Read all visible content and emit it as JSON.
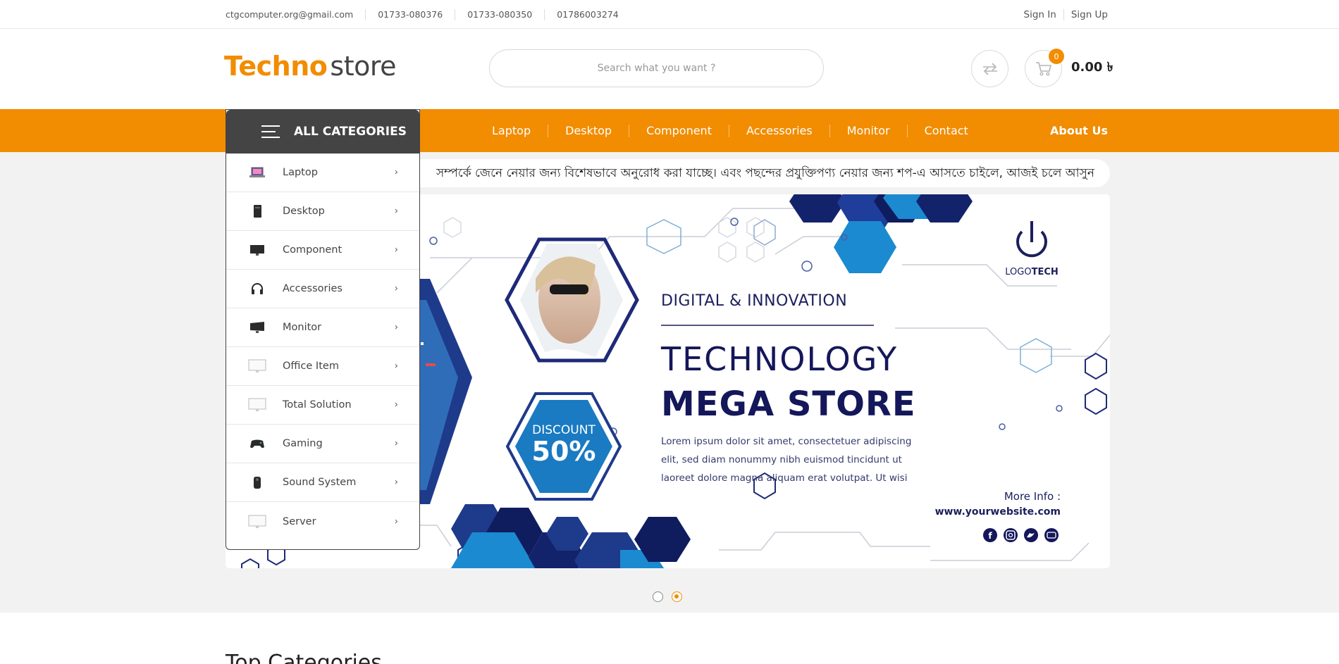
{
  "topbar": {
    "contacts": [
      "ctgcomputer.org@gmail.com",
      "01733-080376",
      "01733-080350",
      "01786003274"
    ],
    "sign_in": "Sign In",
    "sign_up": "Sign Up"
  },
  "header": {
    "logo_part1": "Techno",
    "logo_part2": "store",
    "search_placeholder": "Search what you want ?",
    "cart_count": "0",
    "cart_total": "0.00 ৳"
  },
  "nav": {
    "all_categories": "ALL CATEGORIES",
    "links": [
      "Laptop",
      "Desktop",
      "Component",
      "Accessories",
      "Monitor",
      "Contact"
    ],
    "about": "About Us"
  },
  "categories": [
    {
      "label": "Laptop",
      "icon": "laptop-icon"
    },
    {
      "label": "Desktop",
      "icon": "desktop-tower-icon"
    },
    {
      "label": "Component",
      "icon": "component-icon"
    },
    {
      "label": "Accessories",
      "icon": "headphones-icon"
    },
    {
      "label": "Monitor",
      "icon": "monitor-icon"
    },
    {
      "label": "Office Item",
      "icon": "monitor-outline-icon"
    },
    {
      "label": "Total Solution",
      "icon": "monitor-outline-icon"
    },
    {
      "label": "Gaming",
      "icon": "gamepad-icon"
    },
    {
      "label": "Sound System",
      "icon": "speaker-icon"
    },
    {
      "label": "Server",
      "icon": "monitor-outline-icon"
    }
  ],
  "marquee": "সম্পর্কে জেনে নেয়ার জন্য বিশেষভাবে অনুরোধ করা যাচ্ছে। এবং পছন্দের প্রযুক্তিপণ্য নেয়ার জন্য শপ-এ আসতে চাইলে, আজই চলে আসুন",
  "banner": {
    "logo_text_a": "LOGO",
    "logo_text_b": "TECH",
    "kicker": "DIGITAL & INNOVATION",
    "headline1": "TECHNOLOGY",
    "headline2": "MEGA STORE",
    "discount_label": "DISCOUNT",
    "discount_value": "50%",
    "body": [
      "Lorem ipsum dolor sit amet, consectetuer adipiscing",
      "elit, sed diam nonummy nibh euismod tincidunt ut",
      "laoreet dolore magna aliquam erat volutpat. Ut wisi"
    ],
    "more_info": "More Info :",
    "website": "www.yourwebsite.com",
    "colors": {
      "navy": "#14175a",
      "blue": "#1b8ad0",
      "dark_blue": "#1e2a78"
    }
  },
  "slider": {
    "dot_count": 2,
    "active_dot": 2
  },
  "sections": {
    "top_categories": "Top Categories"
  },
  "colors": {
    "accent": "#f28c00",
    "dark": "#444444"
  }
}
